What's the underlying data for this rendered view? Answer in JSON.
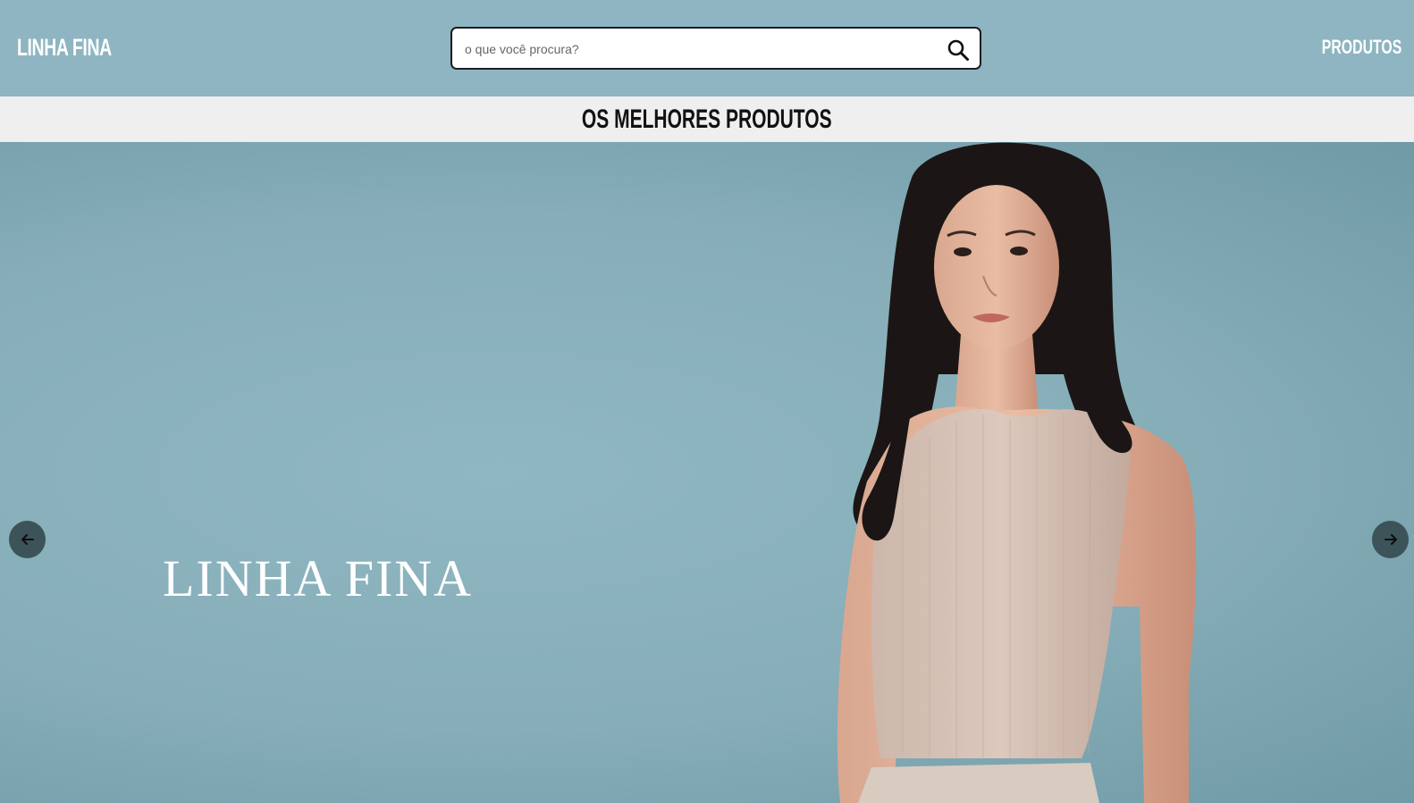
{
  "header": {
    "logo": "LINHA FINA",
    "search": {
      "placeholder": "o que você procura?",
      "value": ""
    },
    "nav_link": "PRODUTOS"
  },
  "band": {
    "title": "OS MELHORES PRODUTOS"
  },
  "hero": {
    "brand_text": "LINHA FINA",
    "prev_icon": "arrow-left-icon",
    "next_icon": "arrow-right-icon"
  },
  "colors": {
    "header_bg": "#8eb5c1",
    "band_bg": "#efefef",
    "hero_bg": "#8db3bf",
    "arrow_bg": "#3c5359"
  }
}
